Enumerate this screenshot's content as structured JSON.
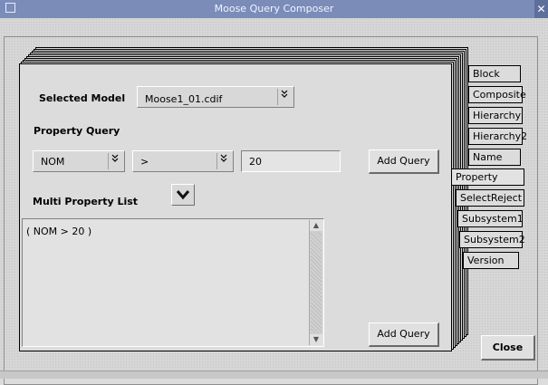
{
  "window": {
    "title": "Moose Query Composer",
    "close_glyph": "✕"
  },
  "form": {
    "selected_model_label": "Selected Model",
    "selected_model_value": "Moose1_01.cdif",
    "property_query_label": "Property Query",
    "property_value": "NOM",
    "operator_value": ">",
    "threshold_value": "20",
    "add_query_label": "Add Query",
    "multi_property_label": "Multi Property List",
    "list_text": "( NOM > 20 )",
    "add_query_bottom_label": "Add Query"
  },
  "tabs": [
    {
      "label": "Block",
      "active": false
    },
    {
      "label": "Composite",
      "active": false
    },
    {
      "label": "Hierarchy",
      "active": false
    },
    {
      "label": "Hierarchy2",
      "active": false
    },
    {
      "label": "Name",
      "active": false
    },
    {
      "label": "Property",
      "active": true
    },
    {
      "label": "SelectReject",
      "active": false
    },
    {
      "label": "Subsystem1",
      "active": false
    },
    {
      "label": "Subsystem2",
      "active": false
    },
    {
      "label": "Version",
      "active": false
    }
  ],
  "footer": {
    "close_label": "Close"
  },
  "icons": {
    "combo_arrow": "double-chevron-down-icon",
    "expand": "chevron-down-icon"
  }
}
